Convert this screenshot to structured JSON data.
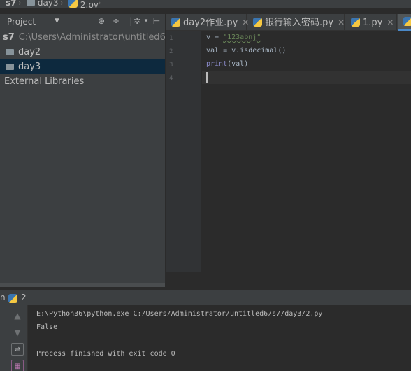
{
  "breadcrumb": {
    "items": [
      "s7",
      "day3",
      "2.py"
    ]
  },
  "project_panel": {
    "title": "Project",
    "tree": [
      {
        "label": "s7",
        "path": "C:\\Users\\Administrator\\untitled6\\s7"
      },
      {
        "label": "day2"
      },
      {
        "label": "day3",
        "selected": true
      },
      {
        "label": "External Libraries"
      }
    ]
  },
  "tabs": [
    {
      "label": "day2作业.py"
    },
    {
      "label": "银行输入密码.py"
    },
    {
      "label": "1.py"
    }
  ],
  "editor": {
    "line_numbers": [
      "1",
      "2",
      "3",
      "4"
    ],
    "lines": {
      "l1_var": "v = ",
      "l1_str": "\"123abnj\"",
      "l2": "val = v.isdecimal()",
      "l3_kw": "print",
      "l3_rest": "(val)"
    }
  },
  "run_panel": {
    "label": "n",
    "config": "2",
    "output": [
      "E:\\Python36\\python.exe C:/Users/Administrator/untitled6/s7/day3/2.py",
      "False",
      "",
      "Process finished with exit code 0"
    ]
  },
  "colors": {
    "background": "#2b2b2b",
    "panel": "#3c3f41",
    "selection": "#0d293e",
    "string": "#6a8759",
    "keyword": "#8888c6",
    "text": "#a9b7c6"
  }
}
